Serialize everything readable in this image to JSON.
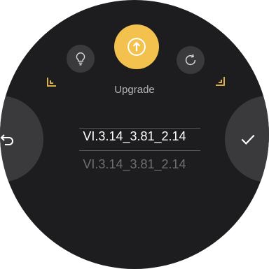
{
  "modes": {
    "left_icon": "lightbulb-icon",
    "center_icon": "upgrade-icon",
    "right_icon": "rotate-icon",
    "label": "Upgrade"
  },
  "version": {
    "current": "VI.3.14_3.81_2.14",
    "next": "VI.3.14_3.81_2.14"
  },
  "actions": {
    "back_icon": "back-arrow-icon",
    "confirm_icon": "checkmark-icon"
  },
  "colors": {
    "accent": "#f2c14e",
    "background": "#1d1d1f",
    "button": "#3a3a3c"
  }
}
